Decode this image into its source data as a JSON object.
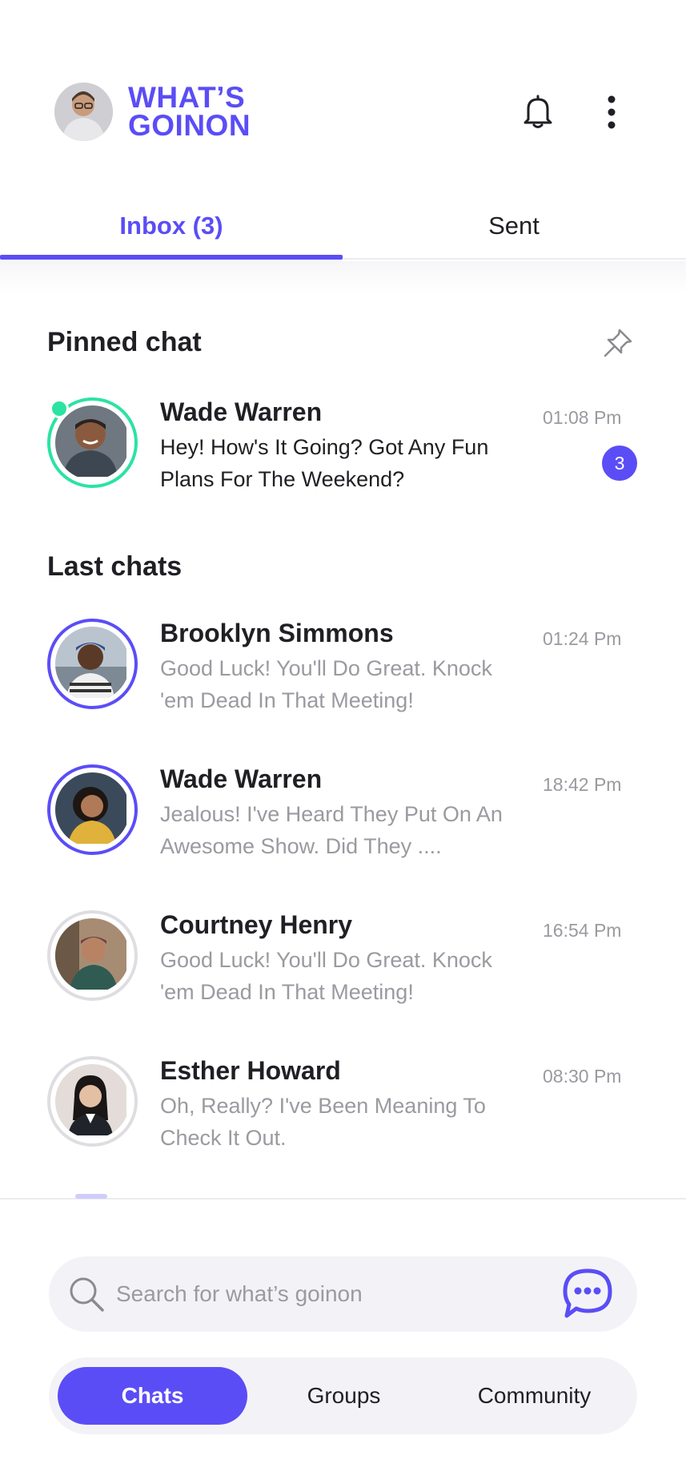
{
  "header": {
    "logo_line1": "WHAT’S",
    "logo_line2": "GOINON",
    "icons": [
      "bell-icon",
      "more-vertical-icon"
    ]
  },
  "tabs": [
    {
      "label": "Inbox (3)",
      "active": true
    },
    {
      "label": "Sent",
      "active": false
    }
  ],
  "pinned": {
    "title": "Pinned chat",
    "chat": {
      "name": "Wade Warren",
      "message": "Hey! How's It Going? Got Any Fun Plans For The Weekend?",
      "time": "01:08 Pm",
      "unread": "3"
    }
  },
  "last": {
    "title": "Last chats",
    "chats": [
      {
        "name": "Brooklyn Simmons",
        "message": "Good Luck! You'll Do Great. Knock 'em Dead In That Meeting!",
        "time": "01:24 Pm"
      },
      {
        "name": "Wade Warren",
        "message": "Jealous! I've Heard They Put On An Awesome Show. Did They ....",
        "time": "18:42 Pm"
      },
      {
        "name": "Courtney Henry",
        "message": "Good Luck! You'll Do Great. Knock 'em Dead In That Meeting!",
        "time": "16:54 Pm"
      },
      {
        "name": "Esther Howard",
        "message": "Oh, Really? I've Been Meaning To Check It Out.",
        "time": "08:30 Pm"
      }
    ]
  },
  "search": {
    "placeholder": "Search for what’s goinon"
  },
  "segments": [
    {
      "label": "Chats",
      "active": true
    },
    {
      "label": "Groups",
      "active": false
    },
    {
      "label": "Community",
      "active": false
    }
  ],
  "colors": {
    "accent": "#5b4df6",
    "online": "#2be3a2"
  }
}
